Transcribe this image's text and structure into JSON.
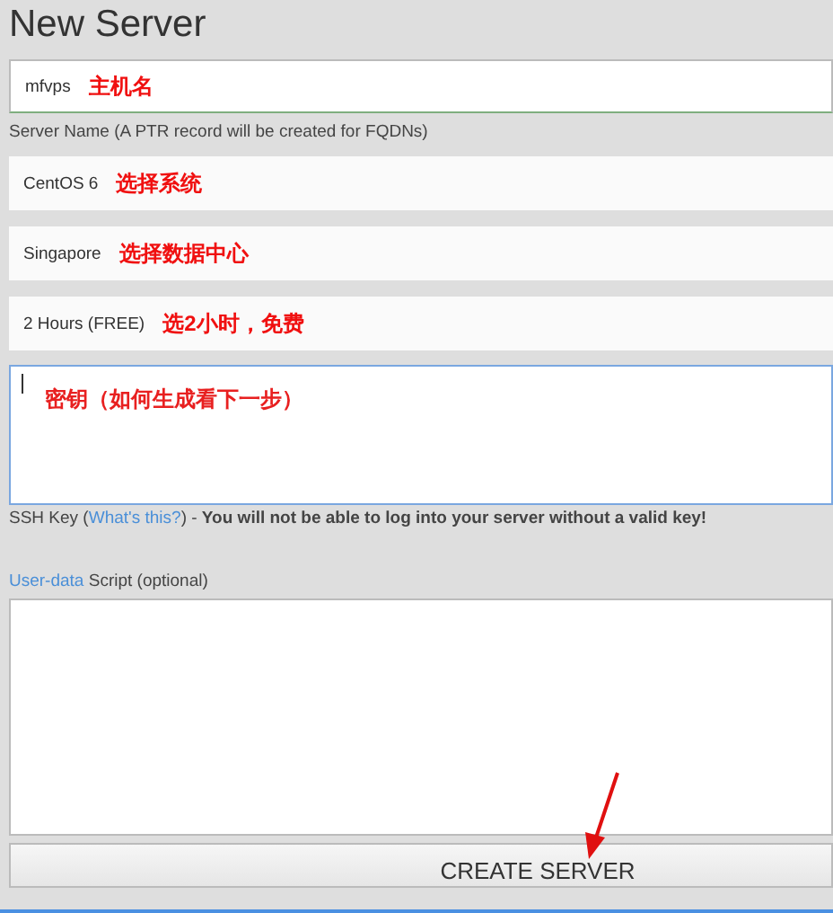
{
  "title": "New Server",
  "name_field": {
    "value": "mfvps",
    "annotation": "主机名",
    "help": "Server Name (A PTR record will be created for FQDNs)"
  },
  "selects": [
    {
      "value": "CentOS 6",
      "annotation": "选择系统"
    },
    {
      "value": "Singapore",
      "annotation": "选择数据中心"
    },
    {
      "value": "2 Hours (FREE)",
      "annotation": "选2小时，免费"
    }
  ],
  "ssh_key": {
    "annotation": "密钥（如何生成看下一步）",
    "help_prefix": "SSH Key (",
    "help_link": "What's this?",
    "help_suffix": ") - **You will not be able to log into your server without a valid key!**"
  },
  "user_data": {
    "label_link": "User-data",
    "label_rest": "Script (optional)"
  },
  "submit": "CREATE SERVER"
}
